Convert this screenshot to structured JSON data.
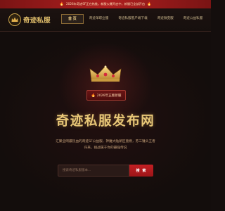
{
  "announcement": {
    "icon": "fire-icon",
    "text": "2026年奇迹SF正在热推，新服火爆开启中，新服已全部开启",
    "color": "#b01f1f"
  },
  "header": {
    "logo": {
      "icon": "crown-logo-icon",
      "text": "奇迹私服"
    },
    "nav": [
      {
        "label": "首 页",
        "active": true
      },
      {
        "label": "奇迹单职业服"
      },
      {
        "label": "奇迹私服客户端下载"
      },
      {
        "label": "奇迹微变服"
      },
      {
        "label": "奇迹公益私服"
      }
    ]
  },
  "hero": {
    "crown_icon": "crown-icon",
    "badge": {
      "icon": "fire-icon",
      "text": "2026年正版新服"
    },
    "title": "奇迹私服发布网",
    "description": "汇聚全网最热血的奇迹SF公益服、神魔大陆新区重燃，苏三锤头王者归来，挑战属于你的最强传说",
    "search": {
      "placeholder": "搜索奇迹私服版本...",
      "button": "搜 索"
    }
  },
  "colors": {
    "accent_gold": "#e8c777",
    "accent_red": "#c21f23",
    "background": "#130d0c"
  }
}
